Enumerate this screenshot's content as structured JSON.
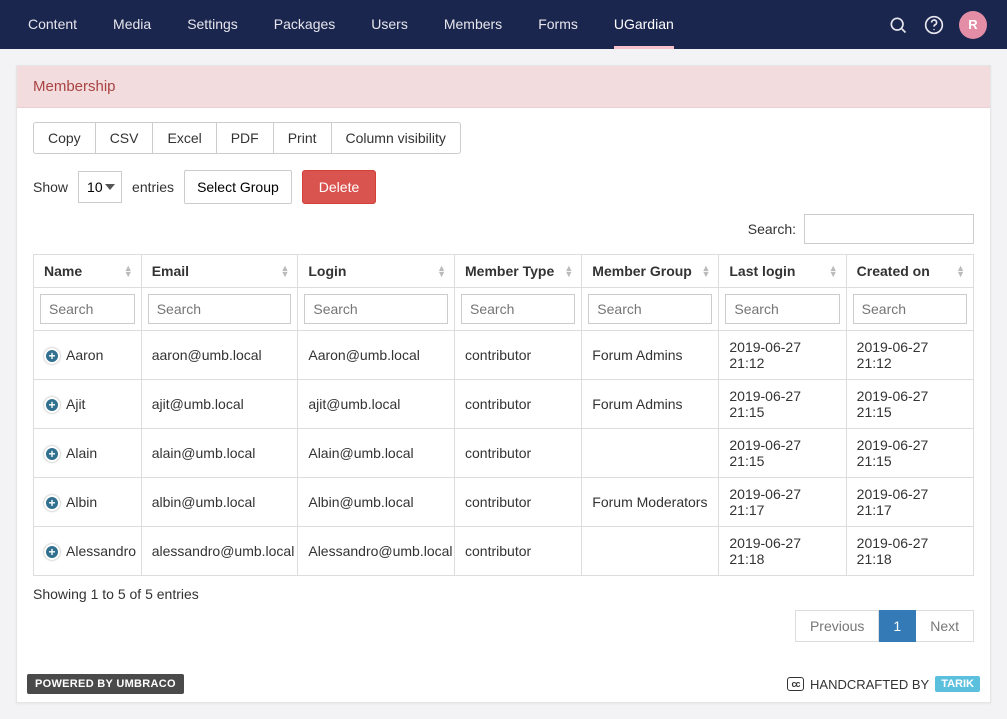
{
  "nav": {
    "items": [
      "Content",
      "Media",
      "Settings",
      "Packages",
      "Users",
      "Members",
      "Forms",
      "UGardian"
    ],
    "active_index": 7,
    "avatar_initial": "R"
  },
  "card": {
    "title": "Membership"
  },
  "buttons": {
    "copy": "Copy",
    "csv": "CSV",
    "excel": "Excel",
    "pdf": "PDF",
    "print": "Print",
    "colvis": "Column visibility"
  },
  "length": {
    "show": "Show",
    "entries": "entries",
    "value": "10"
  },
  "select_group": {
    "label": "Select Group"
  },
  "delete_btn": "Delete",
  "search": {
    "label": "Search:",
    "value": ""
  },
  "columns": [
    "Name",
    "Email",
    "Login",
    "Member Type",
    "Member Group",
    "Last login",
    "Created on"
  ],
  "col_search_placeholder": "Search",
  "rows": [
    {
      "name": "Aaron",
      "email": "aaron@umb.local",
      "login": "Aaron@umb.local",
      "type": "contributor",
      "group": "Forum Admins",
      "last": "2019-06-27 21:12",
      "created": "2019-06-27 21:12"
    },
    {
      "name": "Ajit",
      "email": "ajit@umb.local",
      "login": "ajit@umb.local",
      "type": "contributor",
      "group": "Forum Admins",
      "last": "2019-06-27 21:15",
      "created": "2019-06-27 21:15"
    },
    {
      "name": "Alain",
      "email": "alain@umb.local",
      "login": "Alain@umb.local",
      "type": "contributor",
      "group": "",
      "last": "2019-06-27 21:15",
      "created": "2019-06-27 21:15"
    },
    {
      "name": "Albin",
      "email": "albin@umb.local",
      "login": "Albin@umb.local",
      "type": "contributor",
      "group": "Forum Moderators",
      "last": "2019-06-27 21:17",
      "created": "2019-06-27 21:17"
    },
    {
      "name": "Alessandro",
      "email": "alessandro@umb.local",
      "login": "Alessandro@umb.local",
      "type": "contributor",
      "group": "",
      "last": "2019-06-27 21:18",
      "created": "2019-06-27 21:18"
    }
  ],
  "info": "Showing 1 to 5 of 5 entries",
  "pager": {
    "prev": "Previous",
    "page": "1",
    "next": "Next"
  },
  "footer": {
    "powered": "POWERED BY UMBRACO",
    "hand": "HANDCRAFTED BY",
    "tarik": "TARIK"
  }
}
